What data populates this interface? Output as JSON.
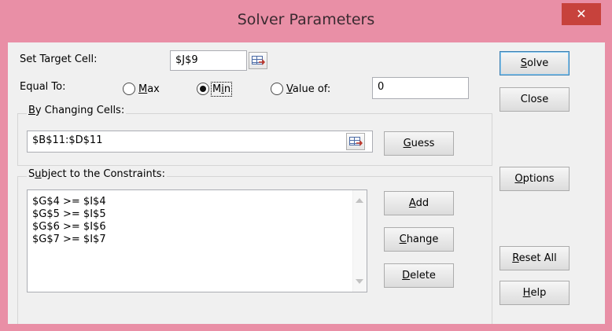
{
  "window": {
    "title": "Solver Parameters",
    "close_glyph": "✕"
  },
  "target": {
    "label_pre": "Set Target Cell:",
    "value": "$J$9"
  },
  "equal_to": {
    "label": "Equal To:",
    "options": [
      {
        "label_pre": "",
        "label_u": "M",
        "label_post": "ax",
        "selected": false
      },
      {
        "label_pre": "M",
        "label_u": "i",
        "label_post": "n",
        "selected": true
      },
      {
        "label_pre": "",
        "label_u": "V",
        "label_post": "alue of:",
        "selected": false
      }
    ],
    "value_of": "0"
  },
  "changing": {
    "label_u": "B",
    "label_post": "y Changing Cells:",
    "value": "$B$11:$D$11"
  },
  "constraints": {
    "label_pre": "S",
    "label_u": "u",
    "label_post": "bject to the Constraints:",
    "items": [
      "$G$4 >= $I$4",
      "$G$5 >= $I$5",
      "$G$6 >= $I$6",
      "$G$7 >= $I$7"
    ]
  },
  "buttons": {
    "solve": {
      "u": "S",
      "rest": "olve"
    },
    "close": {
      "label": "Close"
    },
    "guess": {
      "u": "G",
      "rest": "uess"
    },
    "options": {
      "u": "O",
      "rest": "ptions"
    },
    "add": {
      "u": "A",
      "rest": "dd"
    },
    "change": {
      "u": "C",
      "rest": "hange"
    },
    "delete": {
      "u": "D",
      "rest": "elete"
    },
    "reset": {
      "u": "R",
      "rest": "eset All"
    },
    "help": {
      "u": "H",
      "rest": "elp"
    }
  }
}
